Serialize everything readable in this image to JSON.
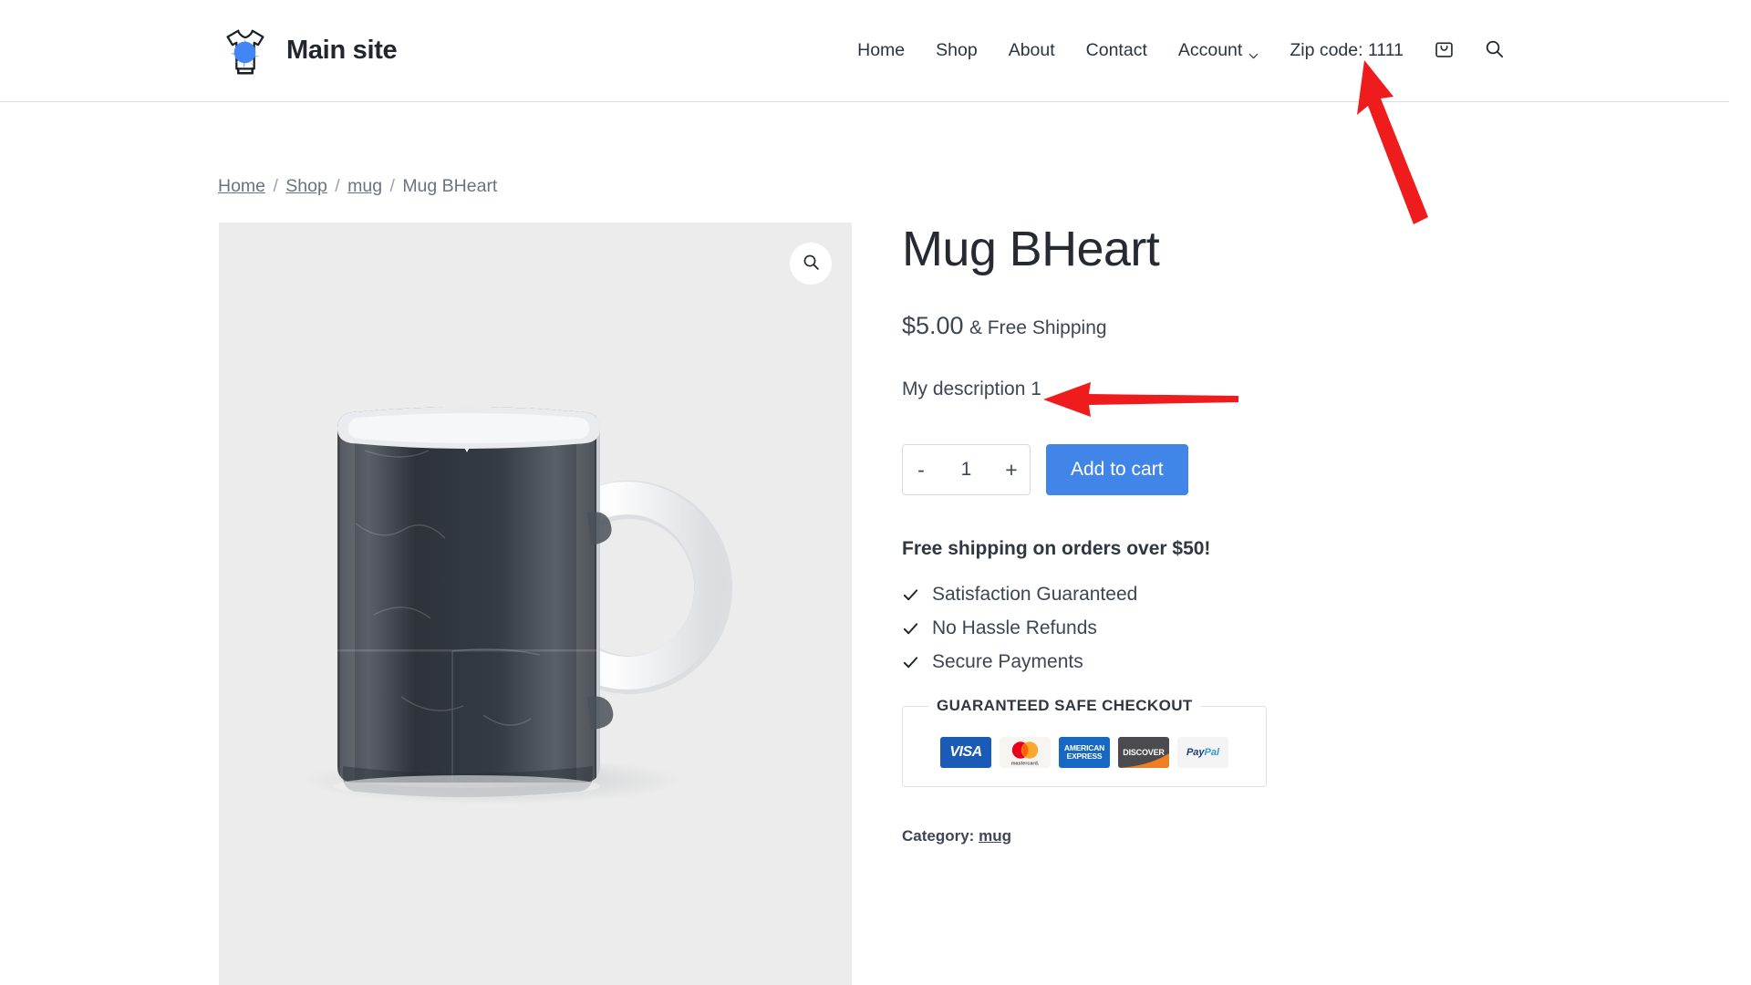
{
  "header": {
    "brand_name": "Main site",
    "logo_icon": "tshirt-splatter-logo",
    "nav": [
      {
        "label": "Home",
        "icon": null
      },
      {
        "label": "Shop",
        "icon": null
      },
      {
        "label": "About",
        "icon": null
      },
      {
        "label": "Contact",
        "icon": null
      },
      {
        "label": "Account",
        "icon": "chevron-down-icon"
      }
    ],
    "zip_code_label": "Zip code: 1111",
    "cart_icon": "shopping-bag-icon",
    "search_icon": "search-icon"
  },
  "breadcrumb": {
    "items": [
      {
        "label": "Home",
        "link": true
      },
      {
        "label": "Shop",
        "link": true
      },
      {
        "label": "mug",
        "link": true
      },
      {
        "label": "Mug BHeart",
        "link": false
      }
    ],
    "separator": "/"
  },
  "gallery": {
    "zoom_icon": "magnifier-icon",
    "image_alt": "Mug BHeart"
  },
  "product": {
    "title": "Mug BHeart",
    "price": "$5.00",
    "price_suffix": "& Free Shipping",
    "short_description": "My description 1",
    "quantity": {
      "decrement_label": "-",
      "value": "1",
      "increment_label": "+"
    },
    "add_to_cart_label": "Add to cart",
    "shipping_note": "Free shipping on orders over $50!",
    "features": [
      "Satisfaction Guaranteed",
      "No Hassle Refunds",
      "Secure Payments"
    ],
    "checkout": {
      "title": "GUARANTEED SAFE CHECKOUT",
      "methods": [
        {
          "name": "VISA",
          "label": "VISA"
        },
        {
          "name": "Mastercard",
          "label": "mastercard."
        },
        {
          "name": "American Express",
          "label_top": "AMERICAN",
          "label_bottom": "EXPRESS"
        },
        {
          "name": "Discover",
          "label": "DISCOVER"
        },
        {
          "name": "PayPal",
          "label_1": "Pay",
          "label_2": "Pal"
        }
      ]
    },
    "category_label": "Category:",
    "category_value": "mug"
  },
  "colors": {
    "accent_blue": "#4285e8",
    "logo_blue": "#4285f4",
    "text_dark": "#22262e",
    "text_body": "#3d4654",
    "muted": "#6b7280",
    "image_bg": "#ececec",
    "annotation_red": "#ee1c1c"
  },
  "annotations": [
    {
      "name": "arrow-to-zip-code",
      "target": "Zip code: 1111"
    },
    {
      "name": "arrow-to-description",
      "target": "My description 1"
    }
  ]
}
